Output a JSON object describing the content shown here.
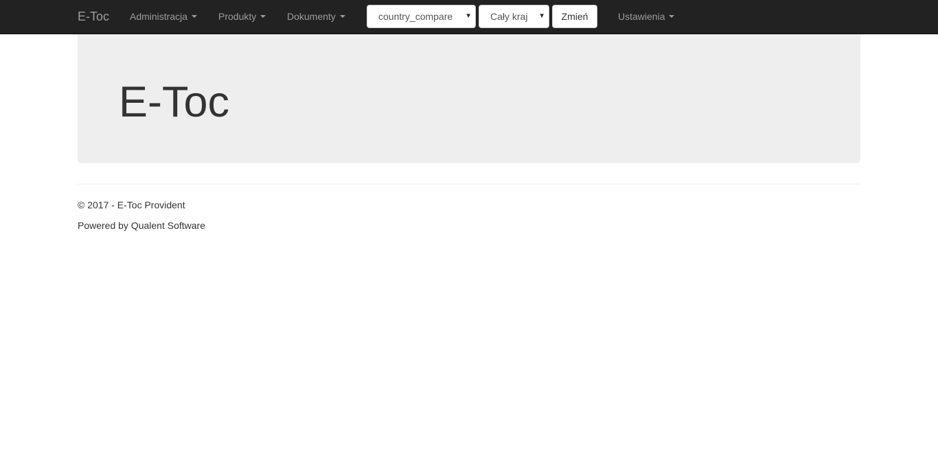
{
  "navbar": {
    "brand": "E-Toc",
    "menu": {
      "administracja": "Administracja",
      "produkty": "Produkty",
      "dokumenty": "Dokumenty",
      "ustawienia": "Ustawienia"
    },
    "country_select": {
      "value": "country_compare"
    },
    "region_select": {
      "value": "Cały kraj"
    },
    "change_button": "Zmień"
  },
  "jumbotron": {
    "title": "E-Toc"
  },
  "footer": {
    "copyright": "© 2017 - E-Toc Provident",
    "powered_by": "Powered by Qualent Software"
  },
  "colors": {
    "navbar_bg": "#222222",
    "navbar_text": "#9d9d9d",
    "jumbotron_bg": "#eeeeee",
    "text": "#333333"
  },
  "icons": {
    "dropdown": "caret-down-icon",
    "select": "select-arrow-icon"
  }
}
